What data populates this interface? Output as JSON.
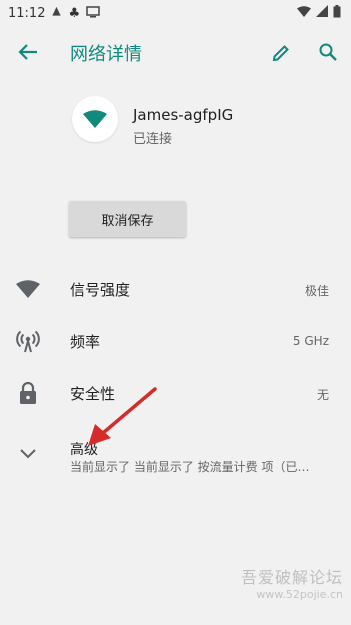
{
  "status_bar": {
    "time": "11:12",
    "icons": [
      "notification-icon",
      "clover-icon",
      "monitor-icon",
      "wifi-icon",
      "signal-icon",
      "battery-icon"
    ]
  },
  "app_bar": {
    "title": "网络详情",
    "back_icon": "arrow-back-icon",
    "edit_icon": "pencil-icon",
    "search_icon": "search-icon",
    "accent_color": "#0f8a7c"
  },
  "network": {
    "name": "James-agfpIG",
    "status": "已连接"
  },
  "forget_button": {
    "label": "取消保存"
  },
  "details": [
    {
      "label": "信号强度",
      "value": "极佳",
      "icon": "wifi-signal-icon"
    },
    {
      "label": "频率",
      "value": "5 GHz",
      "icon": "antenna-icon"
    },
    {
      "label": "安全性",
      "value": "无",
      "icon": "lock-icon"
    }
  ],
  "advanced": {
    "title": "高级",
    "subtitle": "当前显示了 当前显示了 按流量计费 项（已…",
    "icon": "chevron-down-icon"
  },
  "annotation": {
    "arrow_color": "#d62b2b"
  },
  "watermark": {
    "line1": "吾爱破解论坛",
    "line2": "www.52pojie.cn"
  }
}
